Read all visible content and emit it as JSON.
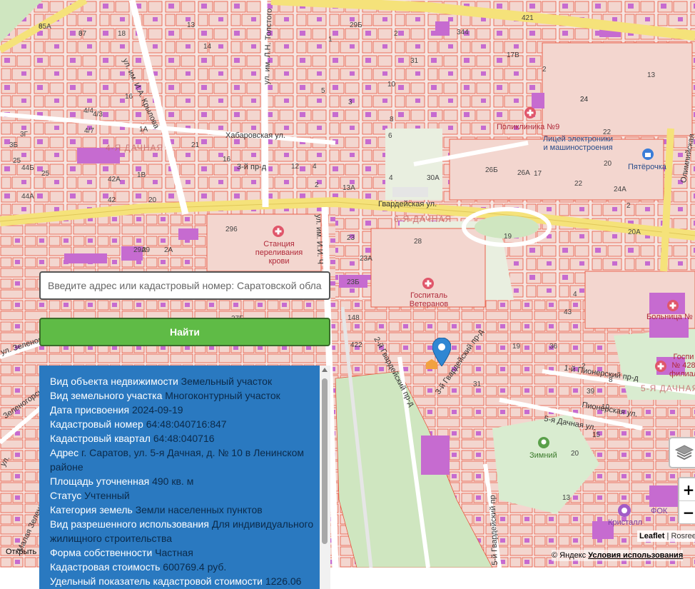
{
  "search": {
    "placeholder": "Введите адрес или кадастровый номер: Саратовской обла",
    "button_label": "Найти"
  },
  "info": {
    "rows": [
      {
        "label": "Вид объекта недвижимости",
        "value": "Земельный участок"
      },
      {
        "label": "Вид земельного участка",
        "value": "Многоконтурный участок"
      },
      {
        "label": "Дата присвоения",
        "value": "2024-09-19"
      },
      {
        "label": "Кадастровый номер",
        "value": "64:48:040716:847"
      },
      {
        "label": "Кадастровый квартал",
        "value": "64:48:040716"
      },
      {
        "label": "Адрес",
        "value": "г. Саратов, ул. 5-я Дачная, д. № 10 в Ленинском районе"
      },
      {
        "label": "Площадь уточненная",
        "value": "490 кв. м"
      },
      {
        "label": "Статус",
        "value": "Учтенный"
      },
      {
        "label": "Категория земель",
        "value": "Земли населенных пунктов"
      },
      {
        "label": "Вид разрешенного использования",
        "value": "Для индивидуального жилищного строительства"
      },
      {
        "label": "Форма собственности",
        "value": "Частная"
      },
      {
        "label": "Кадастровая стоимость",
        "value": "600769.4 руб."
      },
      {
        "label": "Удельный показатель кадастровой стоимости",
        "value": "1226.06"
      }
    ]
  },
  "map": {
    "streets": {
      "gvardeyskaya": "Гвардейская ул.",
      "khabarovskaya": "Хабаровская ул.",
      "krylova": "ул. им. И.А. Крылова",
      "tolstogo": "ул. им. Л.Н. Толстого",
      "pr3": "3-й пр-д",
      "gvard2": "2-й Гвардейский пр-д",
      "gvard3": "3-й Гвардейский пр-д",
      "gvard5": "5-й Гвардейский пр",
      "pioner1": "1-й Пионерский пр-д",
      "pionerskaya": "Пионерская ул.",
      "dachnaya5": "5-я Дачная ул.",
      "olimpiyskaya": "Олимпийская",
      "zelenogo": "ул. Зеленого",
      "zelenogorsk": "Зеленогорск",
      "malaya": "Малая Зеленогорская",
      "ul_short": "ул.",
      "ul_ii": "ул. им. И.И. Ч"
    },
    "districts": {
      "d1": "4-Я ДАЧНАЯ",
      "d2": "6-Я ДАЧНАЯ",
      "d3": "5-Я ДАЧНАЯ"
    },
    "pois": {
      "polyclinic": "Поликлиника №9",
      "lyceum": "Лицей электроники и машиностроения",
      "pyaterochka": "Пятёрочка",
      "blood_station": "Станция переливания крови",
      "veterans": "Госпиталь Ветеранов",
      "hospital": "Больница №",
      "hospital2": "Госпи № 428 филиал",
      "zimniy": "Зимний",
      "kristall": "Кристалл",
      "fok": "ФОК"
    },
    "numbers": [
      "65А",
      "67",
      "18",
      "13",
      "14",
      "16",
      "4/3",
      "4/7",
      "4/4",
      "21",
      "1А",
      "1В",
      "1",
      "20",
      "16",
      "12",
      "4",
      "2",
      "13А",
      "23",
      "23А",
      "23Б",
      "25",
      "24",
      "22",
      "20",
      "28",
      "26А",
      "26Б",
      "30А",
      "2",
      "3",
      "5",
      "10",
      "8",
      "6",
      "4",
      "29Б",
      "31",
      "24",
      "19",
      "17",
      "42",
      "42А",
      "44Б",
      "44А",
      "25",
      "3Г",
      "3Б",
      "2А",
      "29",
      "29А",
      "296",
      "27Б",
      "148",
      "422",
      "421",
      "17В",
      "13",
      "2",
      "20А",
      "22",
      "24А",
      "31",
      "36",
      "19",
      "43",
      "4",
      "2",
      "8",
      "39",
      "20",
      "13",
      "10",
      "15",
      "344",
      "2",
      "8",
      "3"
    ],
    "colors": {
      "background": "#f6e6e2",
      "parcel_stroke": "#e8563f",
      "building": "#c66bd0",
      "road": "#ffffff",
      "main_road": "#f5e27a",
      "green": "#cfe6c0",
      "accent": "#2a79c0",
      "button": "#5fbb46"
    }
  },
  "controls": {
    "zoom_in": "+",
    "zoom_out": "−",
    "attribution_leaflet": "Leaflet",
    "attribution_rest": "| Rosreestr",
    "yandex_prefix": "© Яндекс",
    "yandex_terms": "Условия использования",
    "open_link": "Открыть"
  },
  "icons": {
    "layers": "layers-icon",
    "marker": "map-marker-icon",
    "bus": "bus-stop-icon",
    "hospital": "medical-cross-icon"
  }
}
